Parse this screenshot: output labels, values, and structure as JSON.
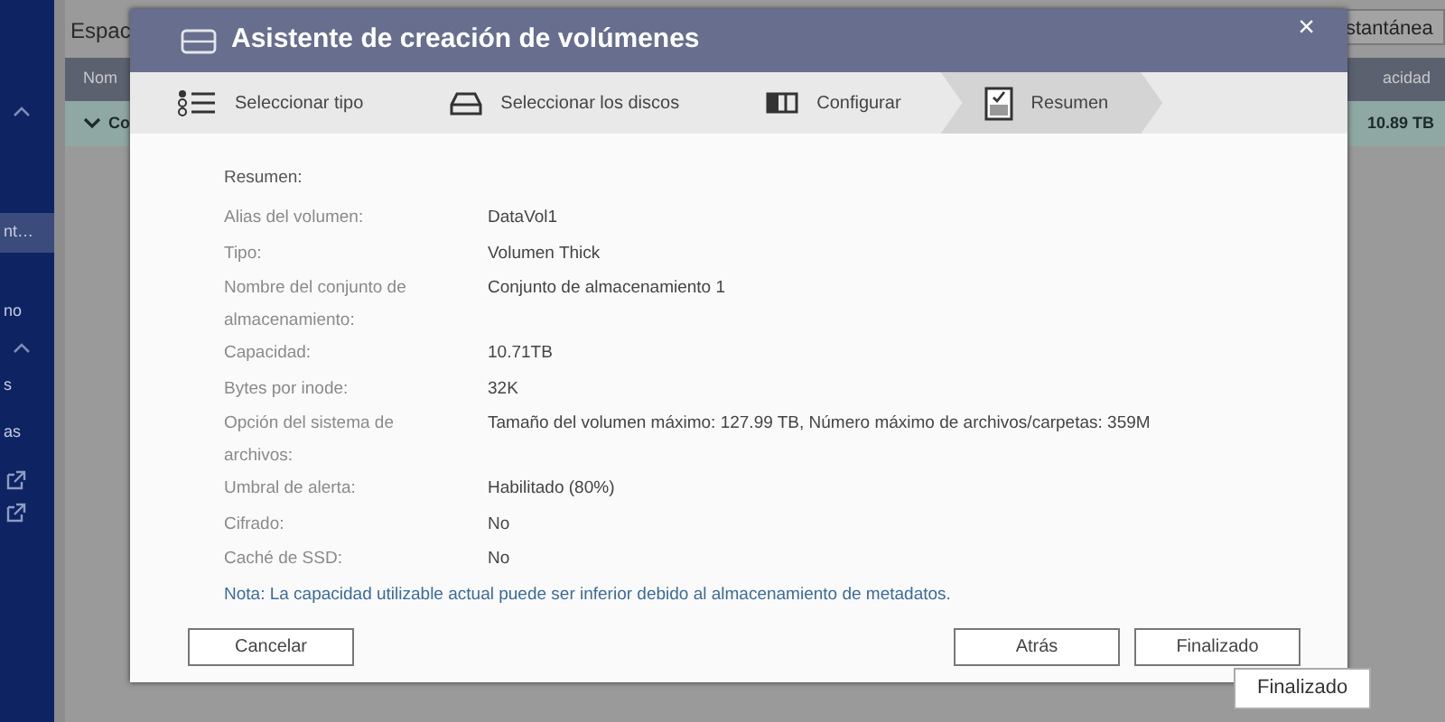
{
  "sidebar": {
    "items": [
      {
        "label": "nt…",
        "selected": true
      },
      {
        "label": "no",
        "selected": false
      },
      {
        "label": "s",
        "selected": false
      },
      {
        "label": "as",
        "selected": false
      }
    ]
  },
  "background": {
    "title": "Espac",
    "button": "stantánea",
    "table": {
      "columns": [
        "Nom",
        "acidad"
      ],
      "rows": [
        {
          "column_1": "Co",
          "column_2": "10.89 TB",
          "expanded": true
        }
      ]
    }
  },
  "dialog": {
    "title": "Asistente de creación de volúmenes",
    "close": "×",
    "steps": [
      {
        "label": "Seleccionar tipo",
        "kind": "list",
        "selected": false
      },
      {
        "label": "Seleccionar los discos",
        "kind": "disk",
        "selected": false
      },
      {
        "label": "Configurar",
        "kind": "columns",
        "selected": false
      },
      {
        "label": "Resumen",
        "kind": "checklist",
        "selected": true
      }
    ],
    "heading": "Resumen:",
    "fields": [
      {
        "label": "Alias del volumen:",
        "value": "DataVol1"
      },
      {
        "label": "Tipo:",
        "value": "Volumen Thick"
      },
      {
        "label": "Nombre del conjunto de almacenamiento:",
        "value": "Conjunto de almacenamiento 1"
      },
      {
        "label": "Capacidad:",
        "value": "10.71TB"
      },
      {
        "label": "Bytes por inode:",
        "value": "32K"
      },
      {
        "label": "Opción del sistema de archivos:",
        "value": "Tamaño del volumen máximo: 127.99 TB, Número máximo de archivos/carpetas: 359M"
      },
      {
        "label": "Umbral de alerta:",
        "value": "Habilitado (80%)"
      },
      {
        "label": "Cifrado:",
        "value": "No"
      },
      {
        "label": "Caché de SSD:",
        "value": "No"
      }
    ],
    "note": "Nota: La capacidad utilizable actual puede ser inferior debido al almacenamiento de metadatos.",
    "buttons": [
      {
        "label": "Cancelar",
        "kind": "left"
      },
      {
        "label": "Atrás",
        "kind": "right"
      },
      {
        "label": "Finalizado",
        "kind": "right"
      }
    ],
    "tooltip": "Finalizado"
  }
}
